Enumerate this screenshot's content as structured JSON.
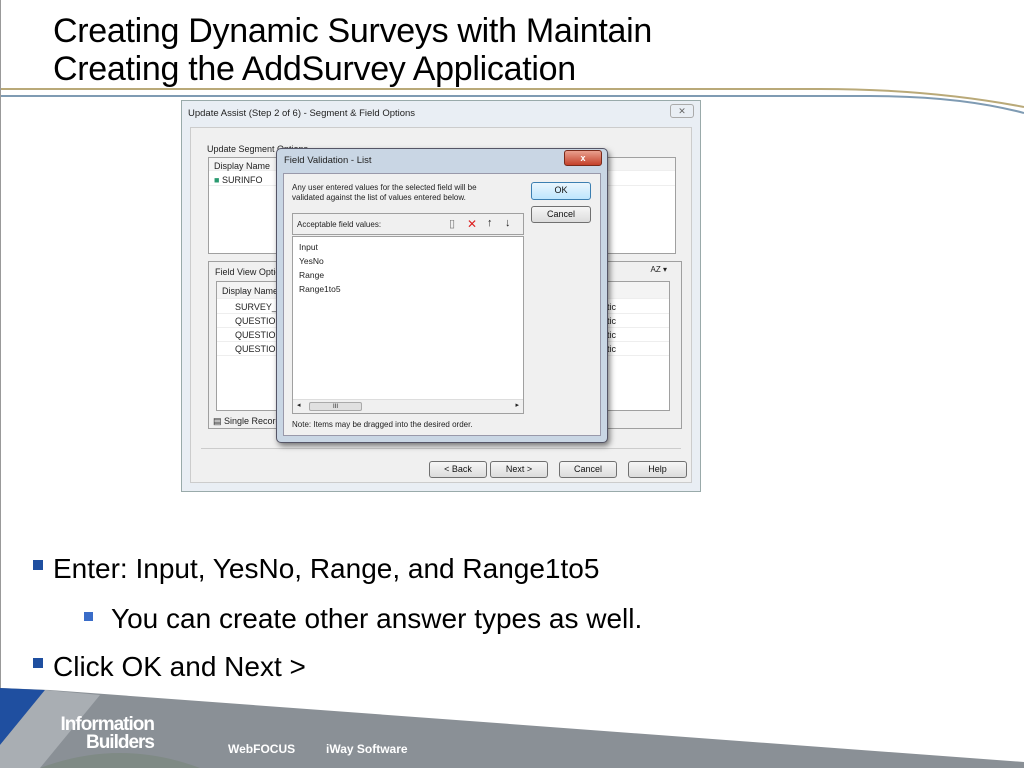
{
  "slide": {
    "title_line1": "Creating Dynamic Surveys with Maintain",
    "title_line2": "Creating the AddSurvey Application"
  },
  "outer_dialog": {
    "title": "Update Assist (Step 2 of 6) - Segment & Field Options",
    "segment_group": "Update Segment Options",
    "segment_header": "Display Name",
    "segment_item": "SURINFO",
    "field_group": "Field View Options",
    "field_header": "Display Name",
    "fields": [
      "SURVEY_N",
      "QUESTION",
      "QUESTION",
      "QUESTION"
    ],
    "field_right": [
      "tic",
      "tic",
      "tic",
      "tic"
    ],
    "sort_label": "AZ",
    "single_record": "Single Record",
    "buttons": {
      "back": "< Back",
      "next": "Next >",
      "cancel": "Cancel",
      "help": "Help"
    }
  },
  "inner_dialog": {
    "title": "Field Validation - List",
    "close": "x",
    "description": "Any user entered values for the selected field will be validated against the list of values entered below.",
    "ok": "OK",
    "cancel": "Cancel",
    "list_label": "Acceptable field values:",
    "values": [
      "Input",
      "YesNo",
      "Range",
      "Range1to5"
    ],
    "scroll_thumb": "III",
    "note": "Note:  Items may be dragged into the desired order."
  },
  "bullets": [
    {
      "text": "Enter: Input, YesNo, Range, and Range1to5"
    },
    {
      "text": "You can create other answer types as well."
    },
    {
      "text": "Click OK and Next >"
    }
  ],
  "footer": {
    "logo_line1": "Information",
    "logo_line2": "Builders",
    "link1": "WebFOCUS",
    "link2": "iWay Software"
  },
  "colors": {
    "accent": "#1f4fa0",
    "footer_gray": "#8a9096",
    "gold_line": "#b9a978",
    "blue_line": "#7f9bb3"
  }
}
